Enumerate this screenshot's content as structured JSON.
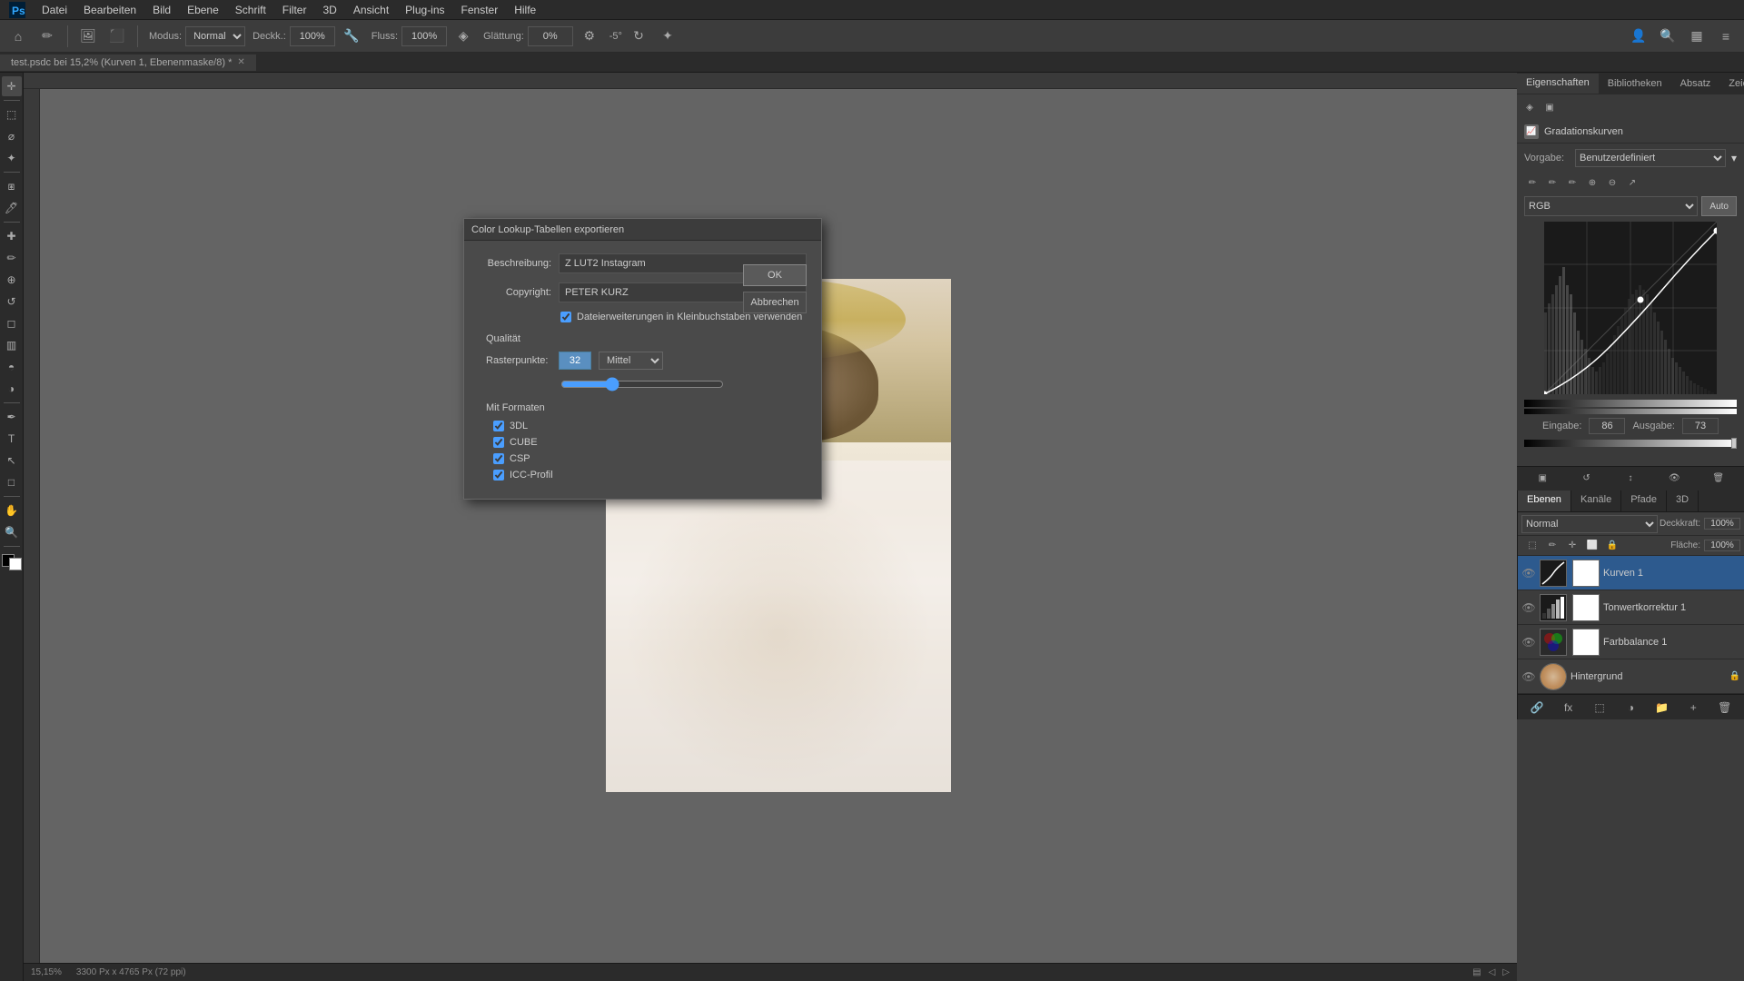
{
  "app": {
    "title": "Adobe Photoshop",
    "file_tab": "test.psdc bei 15,2% (Kurven 1, Ebenenmaske/8) *"
  },
  "menu": {
    "items": [
      "Datei",
      "Bearbeiten",
      "Bild",
      "Ebene",
      "Schrift",
      "Filter",
      "3D",
      "Ansicht",
      "Plug-ins",
      "Fenster",
      "Hilfe"
    ]
  },
  "toolbar": {
    "mode_label": "Modus:",
    "mode_value": "Normal",
    "deckkraft_label": "Deckk.:",
    "deckkraft_value": "100%",
    "fluss_label": "Fluss:",
    "fluss_value": "100%",
    "glaettung_label": "Glättung:",
    "glaettung_value": "0%",
    "val_neg5": "-5°"
  },
  "right_panel_top": {
    "tabs": [
      "Eigenschaften",
      "Bibliotheken",
      "Absatz",
      "Zeichen"
    ],
    "active_tab": "Eigenschaften"
  },
  "eigenschaften": {
    "title": "Gradationskurven",
    "vorgabe_label": "Vorgabe:",
    "vorgabe_value": "Benutzerdefiniert",
    "rgb_label": "RGB",
    "auto_label": "Auto",
    "eingabe_label": "Eingabe:",
    "eingabe_value": "86",
    "ausgabe_label": "Ausgabe:",
    "ausgabe_value": "73"
  },
  "layers_panel": {
    "tabs": [
      "Ebenen",
      "Kanäle",
      "Pfade",
      "3D"
    ],
    "active_tab": "Ebenen",
    "mode_value": "Normal",
    "deckkraft_label": "Deckkraft:",
    "deckkraft_value": "100%",
    "flasche_label": "Fläche:",
    "flasche_value": "100%",
    "layers": [
      {
        "name": "Kurven 1",
        "type": "adjustment",
        "visible": true
      },
      {
        "name": "Tonwertkorrektur 1",
        "type": "adjustment",
        "visible": true
      },
      {
        "name": "Farbbalance 1",
        "type": "adjustment",
        "visible": true
      },
      {
        "name": "Hintergrund",
        "type": "background",
        "visible": true,
        "locked": true
      }
    ]
  },
  "status_bar": {
    "zoom": "15,15%",
    "dimensions": "3300 Px x 4765 Px (72 ppi)"
  },
  "dialog": {
    "title": "Color Lookup-Tabellen exportieren",
    "beschreibung_label": "Beschreibung:",
    "beschreibung_value": "Z LUT2 Instagram",
    "copyright_label": "Copyright:",
    "copyright_value": "PETER KURZ",
    "checkbox_label": "Dateierweiterungen in Kleinbuchstaben verwenden",
    "qualitaet_label": "Qualität",
    "rasterpunkte_label": "Rasterpunkte:",
    "rasterpunkte_value": "32",
    "mittel_value": "Mittel",
    "mit_formaten_label": "Mit Formaten",
    "format_3dl": "3DL",
    "format_cube": "CUBE",
    "format_csp": "CSP",
    "format_icc": "ICC-Profil",
    "ok_label": "OK",
    "abbrechen_label": "Abbrechen",
    "checkbox_3dl": true,
    "checkbox_cube": true,
    "checkbox_csp": true,
    "checkbox_icc": true,
    "checkbox_datei": true
  },
  "colors": {
    "accent_blue": "#2d5a8e",
    "highlight_blue": "#5a8fc0"
  }
}
